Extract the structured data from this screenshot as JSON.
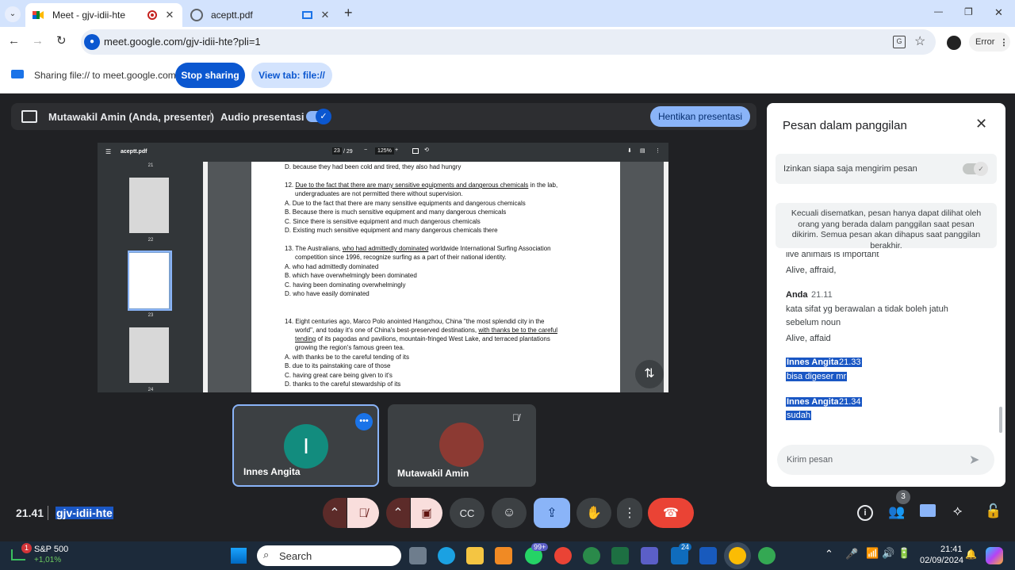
{
  "browser": {
    "tabs": [
      {
        "title": "Meet - gjv-idii-hte",
        "active": true
      },
      {
        "title": "aceptt.pdf",
        "active": false
      }
    ],
    "url": "meet.google.com/gjv-idii-hte?pli=1",
    "profile_label": "Error",
    "new_tab": "+",
    "win_min": "—",
    "win_max": "❐",
    "win_close": "✕"
  },
  "share_bar": {
    "text": "Sharing file:// to meet.google.com",
    "stop": "Stop sharing",
    "view": "View tab: file://"
  },
  "presentation": {
    "presenter": "Mutawakil Amin (Anda, presenter)",
    "audio_label": "Audio presentasi",
    "stop_label": "Hentikan presentasi"
  },
  "pdf": {
    "filename": "aceptt.pdf",
    "page_current": "23",
    "page_total": "/ 29",
    "zoom": "125%",
    "thumb_labels": [
      "21",
      "22",
      "23",
      "24"
    ],
    "lines": [
      "D. because they had been cold and tired, they also had hungry",
      "12.",
      "Due to the fact that there are many sensitive equipments and dangerous chemicals",
      " in the lab,",
      "undergraduates are not permitted there without supervision.",
      "A. Due to the fact that there are many sensitive equipments and dangerous chemicals",
      "B. Because there is much sensitive equipment and many dangerous chemicals",
      "C. Since there is sensitive equipment and much dangerous chemicals",
      "D. Existing much sensitive equipment and many dangerous chemicals there",
      "13. The Australians, ",
      "who had admittedly dominated",
      " worldwide International Surfing Association",
      "competition since 1996, recognize surfing as a part of their national identity.",
      "A. who had admittedly dominated",
      "B. which have overwhelmingly been dominated",
      "C. having been dominating overwhelmingly",
      "D. who have easily dominated",
      "14. Eight centuries ago, Marco Polo anointed Hangzhou, China \"the most splendid city in the",
      "world\", and today it's one of China's best-preserved destinations, ",
      "with thanks be to the careful",
      "tending",
      " of its pagodas and pavilions, mountain-fringed West Lake, and terraced plantations",
      "growing the region's famous green tea.",
      "A. with thanks be to the careful tending of its",
      "B. due to its painstaking care of those",
      "C. having great care being given to it's",
      "D. thanks to the careful stewardship of its"
    ]
  },
  "participants": [
    {
      "name": "Innes Angita",
      "initial": "I",
      "color": "#128c7e"
    },
    {
      "name": "Mutawakil Amin"
    }
  ],
  "chat": {
    "title": "Pesan dalam panggilan",
    "allow_label": "Izinkan siapa saja mengirim pesan",
    "notice": "Kecuali disematkan, pesan hanya dapat dilihat oleh orang yang berada dalam panggilan saat pesan dikirim. Semua pesan akan dihapus saat panggilan berakhir.",
    "cut_line": "live animals is important",
    "messages": [
      {
        "text": "Alive, affraid,"
      },
      {
        "sender": "Anda",
        "time": "21.11",
        "lines": [
          "kata sifat yg berawalan a tidak boleh jatuh",
          "sebelum noun",
          "Alive, affaid"
        ]
      },
      {
        "sender": "Innes Angita",
        "time": "21.33",
        "lines": [
          "bisa digeser mr"
        ]
      },
      {
        "sender": "Innes Angita",
        "time": "21.34",
        "lines": [
          "sudah"
        ]
      }
    ],
    "input_placeholder": "Kirim pesan"
  },
  "meeting": {
    "time": "21.41",
    "code": "gjv-idii-hte",
    "people_count": "3"
  },
  "taskbar": {
    "stock_name": "S&P 500",
    "stock_change": "+1,01%",
    "stock_badge": "1",
    "search": "Search",
    "badge_whatsapp": "99+",
    "badge_outlook": "24",
    "clock_time": "21:41",
    "clock_date": "02/09/2024"
  },
  "colors": {
    "accent": "#0b57d0",
    "meet_bg": "#202124",
    "end_call": "#ea4335",
    "mic_off": "#f9dedc"
  }
}
